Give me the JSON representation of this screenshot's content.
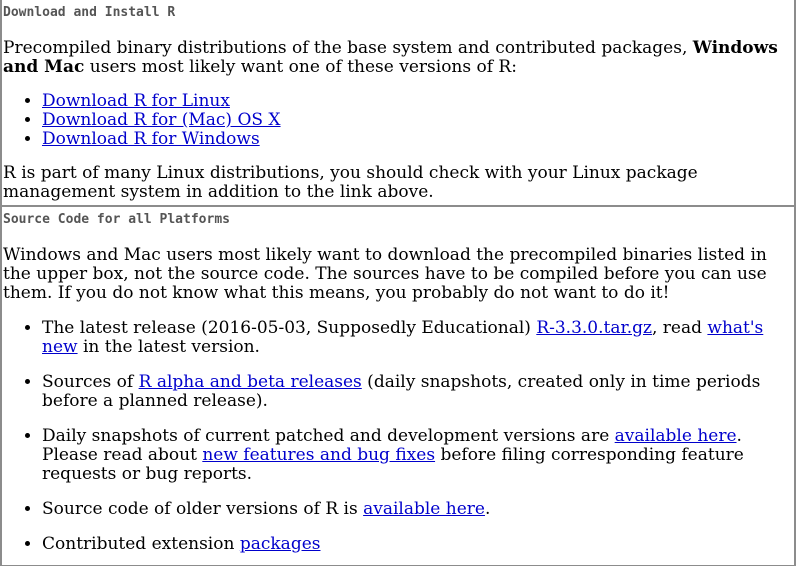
{
  "install": {
    "heading": "Download and Install R",
    "intro_pre": "Precompiled binary distributions of the base system and contributed packages, ",
    "intro_bold": "Windows and Mac",
    "intro_post": " users most likely want one of these versions of R:",
    "links": [
      "Download R for Linux",
      "Download R for (Mac) OS X",
      "Download R for Windows"
    ],
    "outro": "R is part of many Linux distributions, you should check with your Linux package management system in addition to the link above."
  },
  "source": {
    "heading": "Source Code for all Platforms",
    "intro": "Windows and Mac users most likely want to download the precompiled binaries listed in the upper box, not the source code. The sources have to be compiled before you can use them. If you do not know what this means, you probably do not want to do it!",
    "item1": {
      "pre": "The latest release (2016-05-03, Supposedly Educational) ",
      "link1": "R-3.3.0.tar.gz",
      "mid": ", read ",
      "link2": "what's new",
      "post": " in the latest version."
    },
    "item2": {
      "pre": "Sources of ",
      "link": "R alpha and beta releases",
      "post": " (daily snapshots, created only in time periods before a planned release)."
    },
    "item3": {
      "pre": "Daily snapshots of current patched and development versions are ",
      "link1": "available here",
      "mid": ". Please read about ",
      "link2": "new features and bug fixes",
      "post": " before filing corresponding feature requests or bug reports."
    },
    "item4": {
      "pre": "Source code of older versions of R is ",
      "link": "available here",
      "post": "."
    },
    "item5": {
      "pre": "Contributed extension ",
      "link": "packages"
    }
  },
  "colors": {
    "link": "#0000cc",
    "heading": "#555555",
    "border": "#8c8c8c"
  }
}
